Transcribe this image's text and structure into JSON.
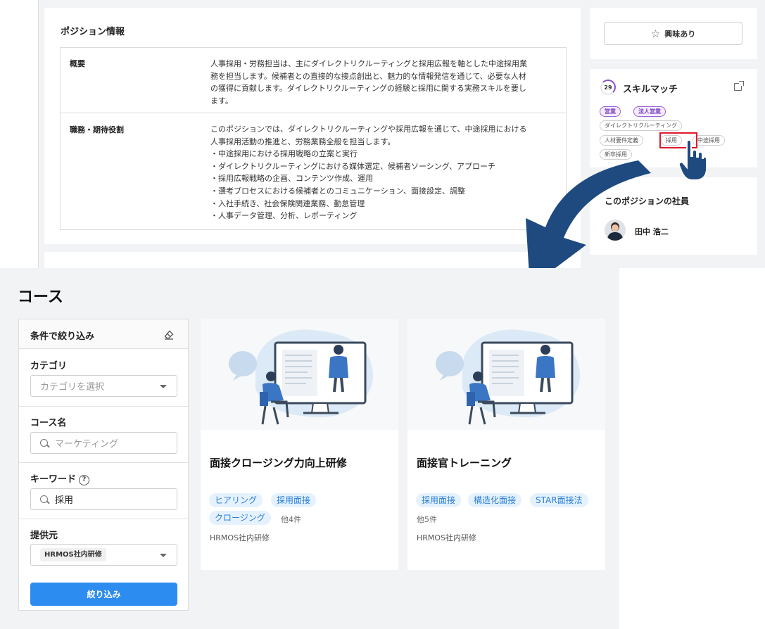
{
  "position": {
    "title": "ポジション情報",
    "summary_label": "概要",
    "summary_lines": [
      "人事採用・労務担当は、主にダイレクトリクルーティングと採用広報を軸とした中途採用業",
      "務を担当します。候補者との直接的な接点創出と、魅力的な情報発信を通じて、必要な人材",
      "の獲得に貢献します。ダイレクトリクルーティングの経験と採用に関する実務スキルを要し",
      "ます。"
    ],
    "duties_label": "職務・期待役割",
    "duties_lines": [
      "このポジションでは、ダイレクトリクルーティングや採用広報を通じて、中途採用における",
      "人事採用活動の推進と、労務業務全般を担当します。",
      "・中途採用における採用戦略の立案と実行",
      "・ダイレクトリクルーティングにおける媒体選定、候補者ソーシング、アプローチ",
      "・採用広報戦略の企画、コンテンツ作成、運用",
      "・選考プロセスにおける候補者とのコミュニケーション、面接設定、調整",
      "・入社手続き、社会保険関連業務、勤怠管理",
      "・人事データ管理、分析、レポーティング"
    ]
  },
  "interest": {
    "label": "興味あり"
  },
  "skill": {
    "score": "29",
    "title": "スキルマッチ",
    "tags": [
      {
        "label": "営業",
        "style": "purple"
      },
      {
        "label": "法人営業",
        "style": "purple"
      },
      {
        "label": "ダイレクトリクルーティング",
        "style": "plain"
      },
      {
        "label": "人材要件定義",
        "style": "plain"
      },
      {
        "label": "採用",
        "style": "plain"
      },
      {
        "label": "中途採用",
        "style": "plain"
      },
      {
        "label": "新卒採用",
        "style": "plain"
      }
    ]
  },
  "employees": {
    "title": "このポジションの社員",
    "items": [
      {
        "name": "田中 浩二"
      }
    ]
  },
  "courses": {
    "heading": "コース",
    "filter": {
      "title": "条件で絞り込み",
      "category_label": "カテゴリ",
      "category_placeholder": "カテゴリを選択",
      "name_label": "コース名",
      "name_placeholder": "マーケティング",
      "keyword_label": "キーワード",
      "keyword_help": "?",
      "keyword_value": "採用",
      "provider_label": "提供元",
      "provider_value": "HRMOS社内研修",
      "apply_label": "絞り込み"
    },
    "cards": [
      {
        "title": "面接クロージング力向上研修",
        "tags": [
          "ヒアリング",
          "採用面接",
          "クロージング"
        ],
        "more": "他4件",
        "provider": "HRMOS社内研修"
      },
      {
        "title": "面接官トレーニング",
        "tags": [
          "採用面接",
          "構造化面接",
          "STAR面接法"
        ],
        "more": "他5件",
        "provider": "HRMOS社内研修"
      }
    ]
  },
  "colors": {
    "accent_blue": "#2d8cf0",
    "arrow_navy": "#1f4a80",
    "highlight_red": "#e0192b",
    "skill_purple": "#8a4fd3"
  }
}
